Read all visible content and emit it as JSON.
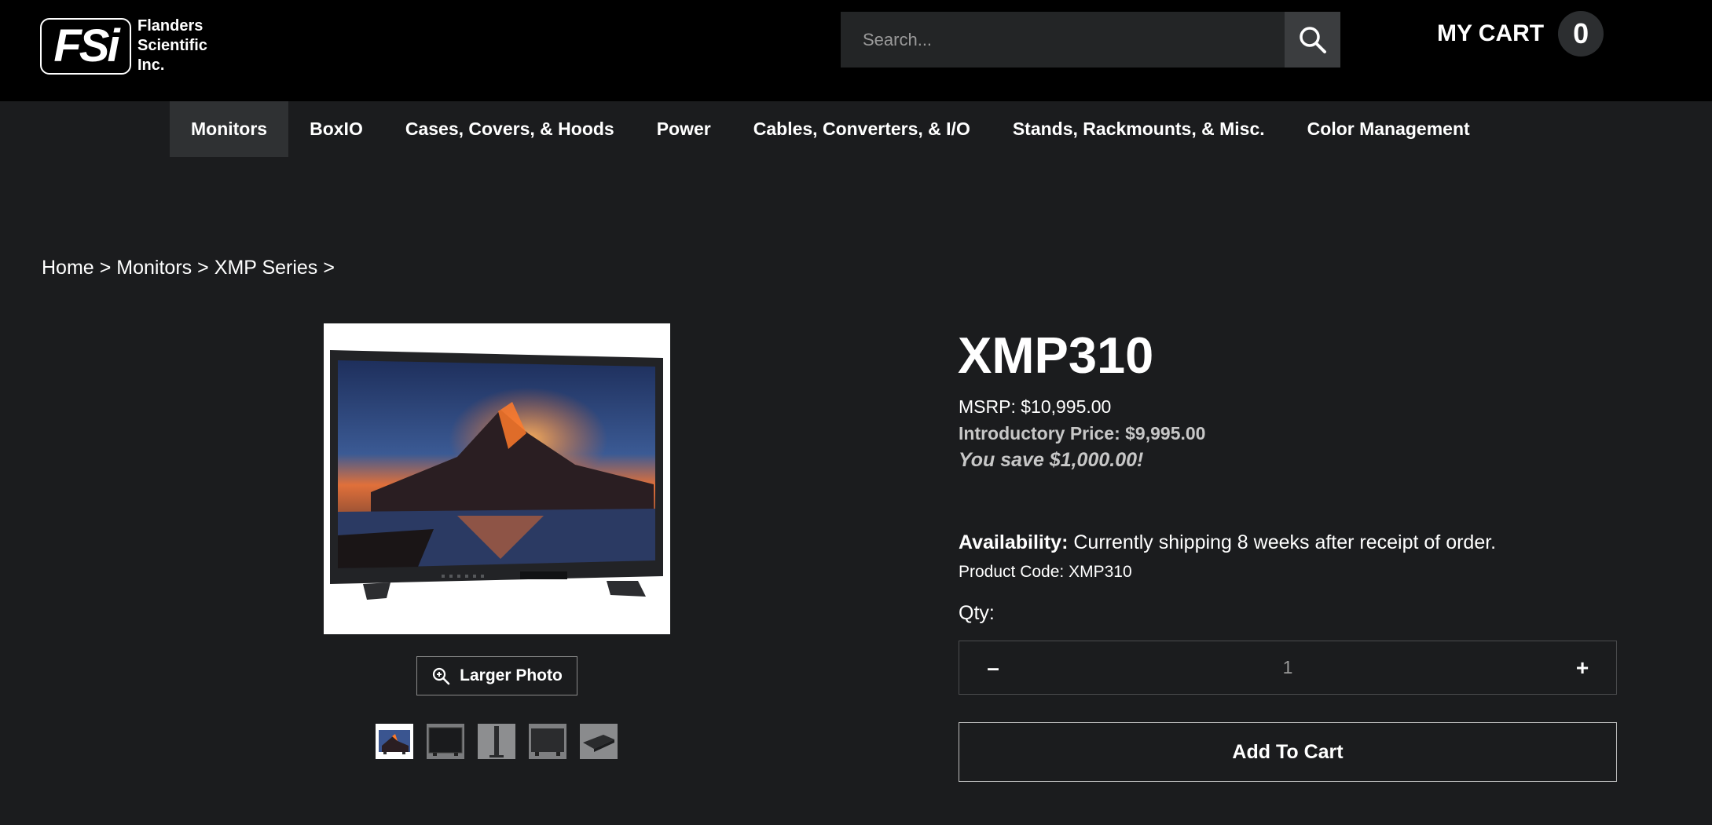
{
  "header": {
    "logo": {
      "mark": "FSi",
      "lines": [
        "Flanders",
        "Scientific",
        "Inc."
      ]
    },
    "search": {
      "placeholder": "Search...",
      "icon": "search-icon"
    },
    "cart": {
      "label": "MY CART",
      "count": "0"
    }
  },
  "nav": {
    "items": [
      {
        "label": "Monitors",
        "active": true
      },
      {
        "label": "BoxIO"
      },
      {
        "label": "Cases, Covers, & Hoods"
      },
      {
        "label": "Power"
      },
      {
        "label": "Cables, Converters, & I/O"
      },
      {
        "label": "Stands, Rackmounts, & Misc."
      },
      {
        "label": "Color Management"
      }
    ]
  },
  "breadcrumb": {
    "items": [
      "Home",
      "Monitors",
      "XMP Series"
    ],
    "separator": ">"
  },
  "gallery": {
    "larger_photo_label": "Larger Photo",
    "larger_photo_icon": "zoom-in-icon",
    "thumbnails": [
      {
        "name": "thumbnail-front-volcano",
        "active": true
      },
      {
        "name": "thumbnail-front-dark"
      },
      {
        "name": "thumbnail-side"
      },
      {
        "name": "thumbnail-back"
      },
      {
        "name": "thumbnail-angle"
      }
    ]
  },
  "product": {
    "title": "XMP310",
    "msrp": "MSRP: $10,995.00",
    "intro_price": "Introductory Price: $9,995.00",
    "savings": "You save $1,000.00!",
    "availability_label": "Availability:",
    "availability_value": "Currently shipping 8 weeks after receipt of order.",
    "product_code": "Product Code: XMP310",
    "qty_label": "Qty:",
    "qty_value": "1",
    "qty_minus": "–",
    "qty_plus": "+",
    "add_to_cart": "Add To Cart"
  },
  "colors": {
    "page_bg": "#1b1c1e",
    "header_bg": "#000000",
    "nav_active_bg": "#2f3133",
    "muted_text": "#c7c7c7"
  }
}
